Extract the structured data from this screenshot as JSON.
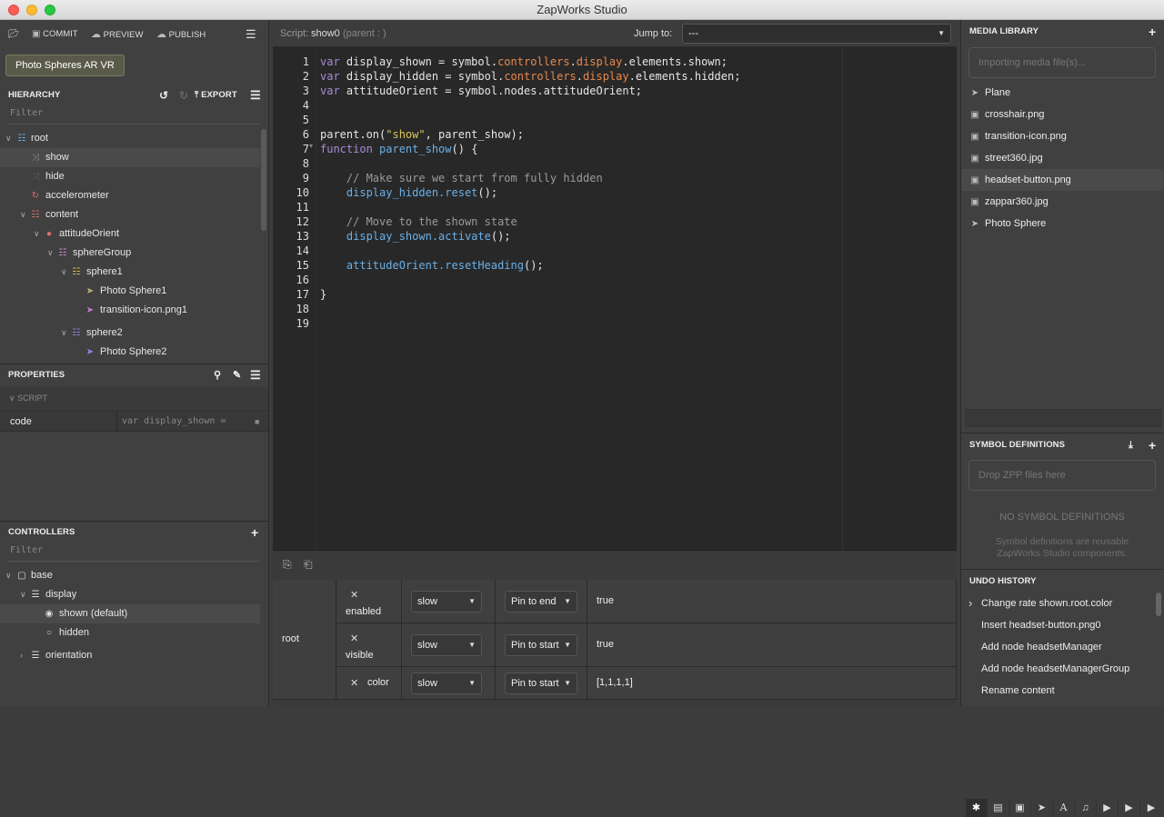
{
  "window": {
    "title": "ZapWorks Studio"
  },
  "toolbar": {
    "commit": "COMMIT",
    "preview": "PREVIEW",
    "publish": "PUBLISH"
  },
  "project": {
    "name": "Photo Spheres AR VR"
  },
  "hierarchy": {
    "title": "HIERARCHY",
    "export": "EXPORT",
    "filter": "Filter",
    "nodes": [
      {
        "label": "root",
        "icon": "hierarchy-icon"
      },
      {
        "label": "show",
        "icon": "shuffle-icon"
      },
      {
        "label": "hide",
        "icon": "shuffle-icon"
      },
      {
        "label": "accelerometer",
        "icon": "refresh-icon"
      },
      {
        "label": "content",
        "icon": "hierarchy-icon"
      },
      {
        "label": "attitudeOrient",
        "icon": "globe-icon"
      },
      {
        "label": "sphereGroup",
        "icon": "hierarchy-icon"
      },
      {
        "label": "sphere1",
        "icon": "hierarchy-icon"
      },
      {
        "label": "Photo Sphere1",
        "icon": "rocket-icon"
      },
      {
        "label": "transition-icon.png1",
        "icon": "rocket-icon"
      },
      {
        "label": "sphere2",
        "icon": "hierarchy-icon"
      },
      {
        "label": "Photo Sphere2",
        "icon": "rocket-icon"
      }
    ]
  },
  "properties": {
    "title": "PROPERTIES",
    "section": "SCRIPT",
    "row_label": "code",
    "row_value": "var display_shown ="
  },
  "controllers": {
    "title": "CONTROLLERS",
    "filter": "Filter",
    "nodes": [
      {
        "label": "base"
      },
      {
        "label": "display"
      },
      {
        "label": "shown (default)"
      },
      {
        "label": "hidden"
      },
      {
        "label": "orientation"
      }
    ]
  },
  "editor": {
    "script_label": "Script:",
    "script_name": "show0",
    "parent_label": "(parent : )",
    "jump_label": "Jump to:",
    "jump_value": "---",
    "line_numbers": [
      "1",
      "2",
      "3",
      "4",
      "5",
      "6",
      "7",
      "8",
      "9",
      "10",
      "11",
      "12",
      "13",
      "14",
      "15",
      "16",
      "17",
      "18",
      "19"
    ]
  },
  "states_table": {
    "node": "root",
    "rows": [
      {
        "prop": "enabled",
        "ease": "slow",
        "pin": "Pin to end",
        "value": "true"
      },
      {
        "prop": "visible",
        "ease": "slow",
        "pin": "Pin to start",
        "value": "true"
      },
      {
        "prop": "color",
        "ease": "slow",
        "pin": "Pin to start",
        "value": "[1,1,1,1]"
      }
    ]
  },
  "media_library": {
    "title": "MEDIA LIBRARY",
    "placeholder": "Importing media file(s)...",
    "items": [
      {
        "label": "Plane",
        "icon": "rocket-icon"
      },
      {
        "label": "crosshair.png",
        "icon": "image-icon"
      },
      {
        "label": "transition-icon.png",
        "icon": "image-icon"
      },
      {
        "label": "street360.jpg",
        "icon": "image-icon"
      },
      {
        "label": "headset-button.png",
        "icon": "image-icon"
      },
      {
        "label": "zappar360.jpg",
        "icon": "image-icon"
      },
      {
        "label": "Photo Sphere",
        "icon": "rocket-icon"
      }
    ]
  },
  "symbol_definitions": {
    "title": "SYMBOL DEFINITIONS",
    "placeholder": "Drop ZPP files here",
    "empty_title": "NO SYMBOL DEFINITIONS",
    "empty_desc": "Symbol definitions are reusable ZapWorks Studio components."
  },
  "undo_history": {
    "title": "UNDO HISTORY",
    "items": [
      "Change rate shown.root.color",
      "Insert headset-button.png0",
      "Add node headsetManager",
      "Add node headsetManagerGroup",
      "Rename content"
    ]
  }
}
